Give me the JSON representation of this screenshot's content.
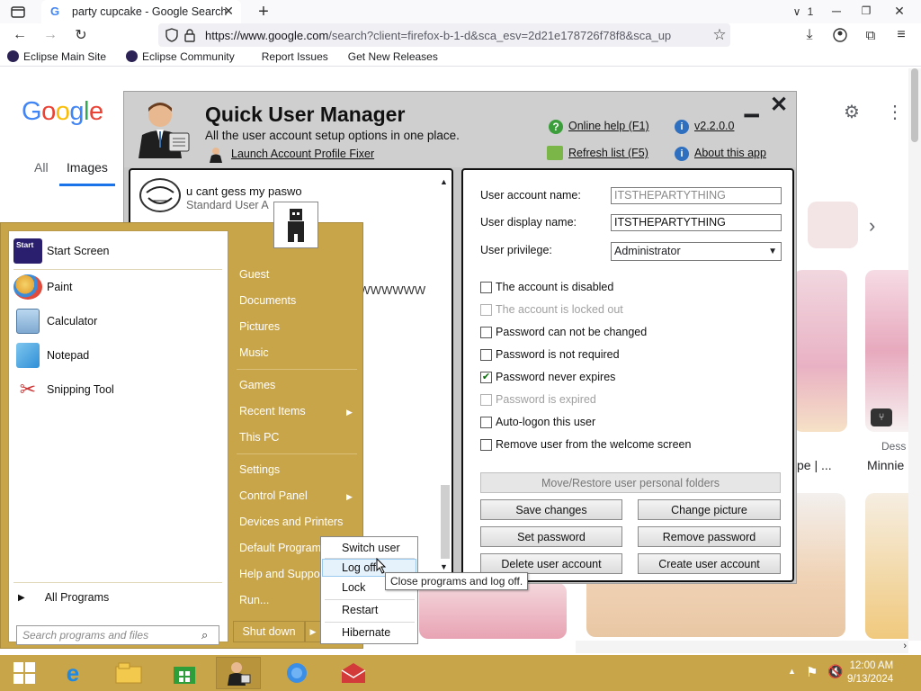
{
  "browser": {
    "tab_title": "party cupcake - Google Search",
    "tab_count": "1",
    "url_host": "https://www.google.com",
    "url_rest": "/search?client=firefox-b-1-d&sca_esv=2d21e178726f78f8&sca_up",
    "bookmarks": [
      "Eclipse Main Site",
      "Eclipse Community",
      "Report Issues",
      "Get New Releases"
    ]
  },
  "google": {
    "nav_all": "All",
    "nav_images": "Images",
    "logo_letters": [
      "G",
      "o",
      "o",
      "g",
      "l",
      "e"
    ],
    "logo_colors": [
      "#4285f4",
      "#ea4335",
      "#fbbc05",
      "#4285f4",
      "#34a853",
      "#ea4335"
    ],
    "captions": [
      "pe | ...",
      "Minnie",
      "Dess"
    ]
  },
  "qum": {
    "title": "Quick User Manager",
    "subtitle": "All the user account setup options in one place.",
    "launch_fixer": "Launch Account Profile Fixer",
    "online_help": "Online help (F1)",
    "refresh": "Refresh list (F5)",
    "version": "v2.2.0.0",
    "about": "About this app",
    "user_name": "u cant gess my paswo",
    "user_type": "Standard User A",
    "ghost_text": "WWWWWWWW",
    "labels": {
      "account_name": "User account name:",
      "display_name": "User display name:",
      "privilege": "User privilege:"
    },
    "values": {
      "account_name": "ITSTHEPARTYTHING",
      "display_name": "ITSTHEPARTYTHING",
      "privilege": "Administrator"
    },
    "checkboxes": [
      {
        "label": "The account is disabled",
        "checked": false,
        "enabled": true
      },
      {
        "label": "The account is locked out",
        "checked": false,
        "enabled": false
      },
      {
        "label": "Password can not be changed",
        "checked": false,
        "enabled": true
      },
      {
        "label": "Password is not required",
        "checked": false,
        "enabled": true
      },
      {
        "label": "Password never expires",
        "checked": true,
        "enabled": true
      },
      {
        "label": "Password is expired",
        "checked": false,
        "enabled": false
      },
      {
        "label": "Auto-logon this user",
        "checked": false,
        "enabled": true
      },
      {
        "label": "Remove user from the welcome screen",
        "checked": false,
        "enabled": true
      }
    ],
    "buttons": {
      "move_restore": "Move/Restore user personal folders",
      "save": "Save changes",
      "change_picture": "Change picture",
      "set_password": "Set password",
      "remove_password": "Remove password",
      "delete": "Delete user account",
      "create": "Create user account"
    }
  },
  "startmenu": {
    "left_items": [
      "Start Screen",
      "Paint",
      "Calculator",
      "Notepad",
      "Snipping Tool"
    ],
    "start_icon_text": "Start",
    "all_programs": "All Programs",
    "search_placeholder": "Search programs and files",
    "right_items": [
      "Guest",
      "Documents",
      "Pictures",
      "Music",
      "Games",
      "Recent Items",
      "This PC",
      "Settings",
      "Control Panel",
      "Devices and Printers",
      "Default Programs",
      "Help and Support",
      "Run..."
    ],
    "shutdown": "Shut down"
  },
  "shutdown_menu": {
    "items": [
      "Switch user",
      "Log off",
      "Lock",
      "Restart",
      "Hibernate"
    ],
    "tooltip": "Close programs and log off."
  },
  "taskbar": {
    "time": "12:00 AM",
    "date": "9/13/2024"
  }
}
